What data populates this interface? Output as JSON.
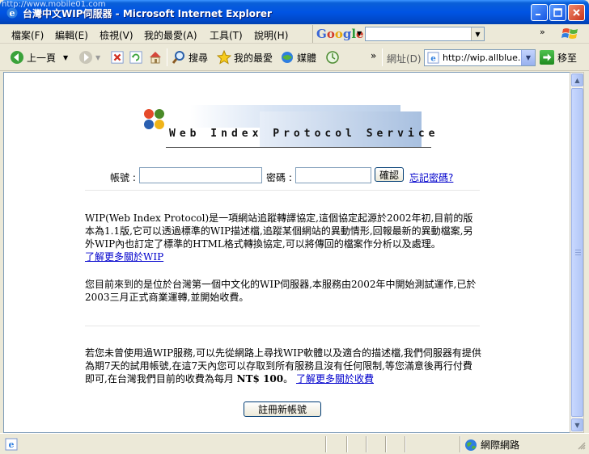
{
  "window": {
    "title": "台灣中文WIP伺服器 - Microsoft Internet Explorer",
    "url_overlay": "http://www.mobile01.com"
  },
  "menu": {
    "items": [
      "檔案(F)",
      "編輯(E)",
      "檢視(V)",
      "我的最愛(A)",
      "工具(T)",
      "說明(H)"
    ],
    "google_logo": "Google",
    "google_search_value": "",
    "chevrons": "»"
  },
  "toolbar": {
    "back_label": "上一頁",
    "search_label": "搜尋",
    "favorites_label": "我的最愛",
    "media_label": "媒體",
    "chevrons": "»",
    "address_label": "網址(D)",
    "address_value": "http://wip.allblue.cc",
    "go_label": "移至"
  },
  "logo": {
    "text": "Web Index Protocol Service"
  },
  "login": {
    "account_label": "帳號 :",
    "account_value": "",
    "password_label": "密碼 :",
    "password_value": "",
    "confirm_label": "確認",
    "forgot_link": "忘記密碼?"
  },
  "content": {
    "intro": "WIP(Web Index Protocol)是一項網站追蹤轉譯協定,這個協定起源於2002年初,目前的版本為1.1版,它可以透過標準的WIP描述檔,追蹤某個網站的異動情形,回報最新的異動檔案,另外WIP內也訂定了標準的HTML格式轉換協定,可以將傳回的檔案作分析以及處理。",
    "intro_link": "了解更多關於WIP",
    "service": "您目前來到的是位於台灣第一個中文化的WIP伺服器,本服務由2002年中開始測試運作,已於2003三月正式商業運轉,並開始收費。",
    "trial": "若您未曾使用過WIP服務,可以先從網路上尋找WIP軟體以及適合的描述檔,我們伺服器有提供為期7天的試用帳號,在這7天內您可以存取到所有服務且沒有任何限制,等您滿意後再行付費即可,在台灣我們目前的收費為每月",
    "price": "NT$ 100",
    "trial_end": "。",
    "fee_link": "了解更多關於收費",
    "register_label": "註冊新帳號"
  },
  "status": {
    "text": "",
    "zone_label": "網際網路"
  },
  "colors": {
    "titlebar": "#0054e3",
    "link": "#0000cc"
  }
}
